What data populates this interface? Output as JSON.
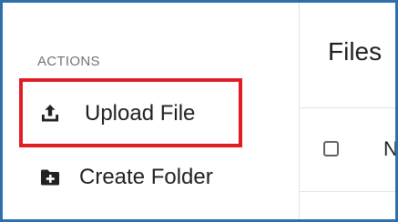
{
  "sidebar": {
    "section_label": "ACTIONS",
    "items": [
      {
        "label": "Upload File",
        "icon": "upload-icon"
      },
      {
        "label": "Create Folder",
        "icon": "folder-add-icon"
      }
    ]
  },
  "main": {
    "title": "Files",
    "table": {
      "first_column_header": "N"
    }
  },
  "colors": {
    "frame_border": "#2f6fad",
    "highlight": "#e11d23",
    "text": "#202124",
    "muted": "#737373"
  }
}
